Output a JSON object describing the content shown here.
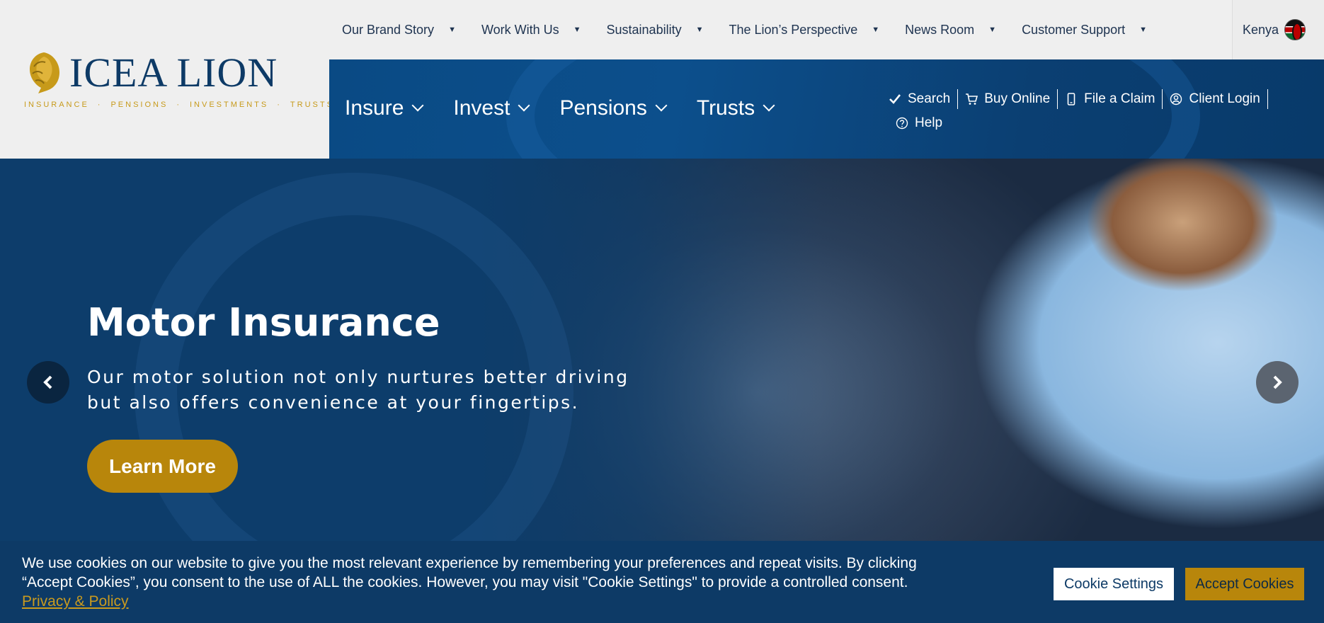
{
  "brand": {
    "name": "ICEA LION",
    "tagline": [
      "INSURANCE",
      "PENSIONS",
      "INVESTMENTS",
      "TRUSTS"
    ],
    "primary_color": "#0d3a66",
    "accent_color": "#b8860b"
  },
  "topnav": {
    "items": [
      {
        "label": "Our Brand Story"
      },
      {
        "label": "Work With Us"
      },
      {
        "label": "Sustainability"
      },
      {
        "label": "The Lion’s Perspective"
      },
      {
        "label": "News Room"
      },
      {
        "label": "Customer Support"
      }
    ],
    "country": "Kenya"
  },
  "mainnav": {
    "items": [
      {
        "label": "Insure"
      },
      {
        "label": "Invest"
      },
      {
        "label": "Pensions"
      },
      {
        "label": "Trusts"
      }
    ],
    "utilities": [
      {
        "label": "Search",
        "icon": "check-icon"
      },
      {
        "label": "Buy Online",
        "icon": "cart-icon"
      },
      {
        "label": "File a Claim",
        "icon": "phone-icon"
      },
      {
        "label": "Client Login",
        "icon": "user-icon"
      },
      {
        "label": "Help",
        "icon": "help-icon"
      }
    ]
  },
  "hero": {
    "title": "Motor Insurance",
    "subtitle_line1": "Our motor solution not only nurtures better driving",
    "subtitle_line2": "but also offers convenience at your fingertips.",
    "cta": "Learn More"
  },
  "cookie": {
    "text": "We use cookies on our website to give you the most relevant experience by remembering your preferences and repeat visits. By clicking “Accept Cookies”, you consent to the use of ALL the cookies. However, you may visit \"Cookie Settings\" to provide a controlled consent.",
    "link": "Privacy & Policy",
    "settings_label": "Cookie Settings",
    "accept_label": "Accept Cookies"
  }
}
